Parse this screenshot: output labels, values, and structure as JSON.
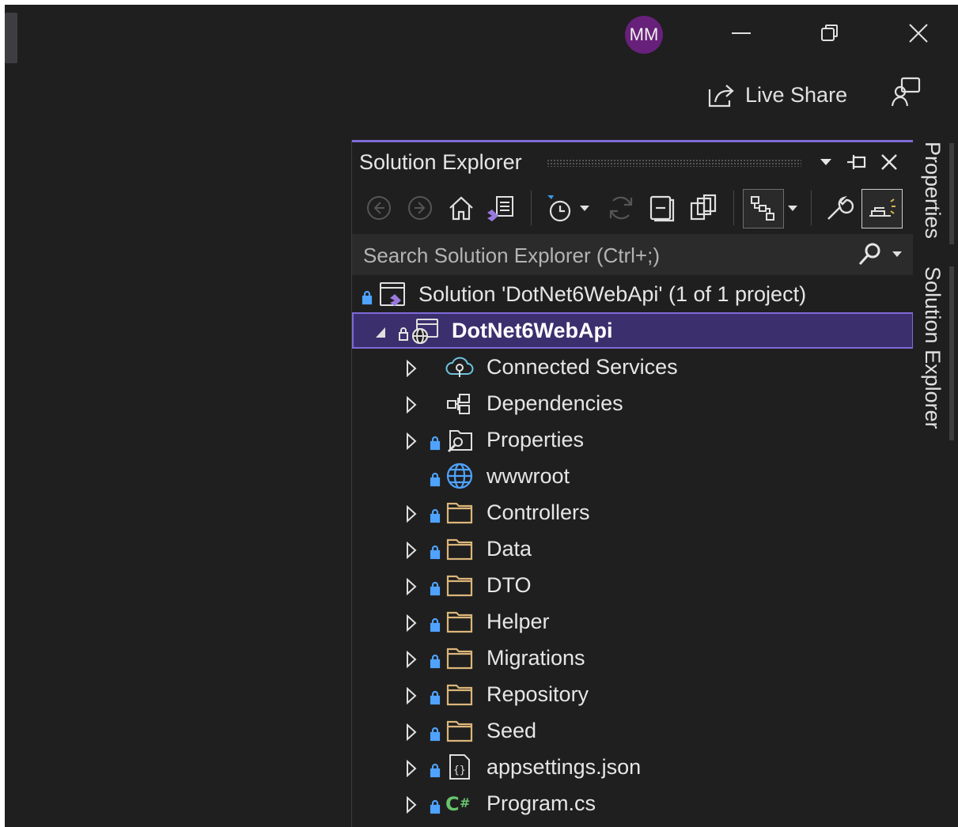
{
  "titlebar": {
    "avatar_initials": "MM",
    "minimize_icon": "minimize-icon",
    "restore_icon": "restore-icon",
    "close_icon": "close-icon"
  },
  "commandbar": {
    "live_share_label": "Live Share",
    "feedback_icon": "feedback-icon"
  },
  "solution_explorer": {
    "title": "Solution Explorer",
    "search": {
      "placeholder": "Search Solution Explorer (Ctrl+;)",
      "value": ""
    },
    "toolbar_icons": [
      "back-icon",
      "forward-icon",
      "home-icon",
      "switch-views-icon",
      "pending-changes-filter-icon",
      "dropdown-icon",
      "refresh-icon",
      "collapse-all-icon",
      "show-all-files-icon",
      "view-class-diagram-icon",
      "dropdown-icon",
      "properties-icon",
      "preview-selected-items-icon"
    ],
    "tree": [
      {
        "label": "Solution 'DotNet6WebApi' (1 of 1 project)",
        "icon": "solution-icon",
        "level": 0,
        "arrow": false,
        "lock": true
      },
      {
        "label": "DotNet6WebApi",
        "icon": "web-project-icon",
        "level": 1,
        "arrow": "expanded",
        "lock": true,
        "selected": true
      },
      {
        "label": "Connected Services",
        "icon": "connected-services-icon",
        "level": 2,
        "arrow": "collapsed",
        "lock": false
      },
      {
        "label": "Dependencies",
        "icon": "dependencies-icon",
        "level": 2,
        "arrow": "collapsed",
        "lock": false
      },
      {
        "label": "Properties",
        "icon": "properties-folder-icon",
        "level": 2,
        "arrow": "collapsed",
        "lock": true
      },
      {
        "label": "wwwroot",
        "icon": "globe-icon",
        "level": 2,
        "arrow": false,
        "lock": true
      },
      {
        "label": "Controllers",
        "icon": "folder-icon",
        "level": 2,
        "arrow": "collapsed",
        "lock": true
      },
      {
        "label": "Data",
        "icon": "folder-icon",
        "level": 2,
        "arrow": "collapsed",
        "lock": true
      },
      {
        "label": "DTO",
        "icon": "folder-icon",
        "level": 2,
        "arrow": "collapsed",
        "lock": true
      },
      {
        "label": "Helper",
        "icon": "folder-icon",
        "level": 2,
        "arrow": "collapsed",
        "lock": true
      },
      {
        "label": "Migrations",
        "icon": "folder-icon",
        "level": 2,
        "arrow": "collapsed",
        "lock": true
      },
      {
        "label": "Repository",
        "icon": "folder-icon",
        "level": 2,
        "arrow": "collapsed",
        "lock": true
      },
      {
        "label": "Seed",
        "icon": "folder-icon",
        "level": 2,
        "arrow": "collapsed",
        "lock": true
      },
      {
        "label": "appsettings.json",
        "icon": "json-file-icon",
        "level": 2,
        "arrow": "collapsed",
        "lock": true
      },
      {
        "label": "Program.cs",
        "icon": "csharp-file-icon",
        "level": 2,
        "arrow": "collapsed",
        "lock": true
      }
    ]
  },
  "side_tabs": {
    "properties_label": "Properties",
    "solution_explorer_label": "Solution Explorer"
  },
  "colors": {
    "background": "#1f1f1f",
    "accent": "#7f6ad8",
    "selection": "#3c2f6e",
    "folder": "#dcb67a",
    "lock": "#4fa3ff",
    "avatar": "#68217a"
  }
}
